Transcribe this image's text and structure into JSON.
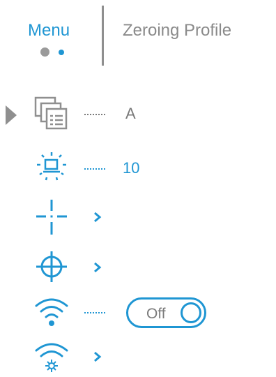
{
  "colors": {
    "accent": "#1f96d3",
    "muted": "#8f8f8f",
    "text_gray": "#7a7a7a"
  },
  "header": {
    "tabs": [
      {
        "label": "Menu",
        "active": true
      },
      {
        "label": "Zeroing Profile",
        "active": false
      }
    ],
    "page_indicator": {
      "pages": 2,
      "current": 2
    }
  },
  "menu": {
    "items": [
      {
        "icon": "profile-copy-icon",
        "value": "A",
        "selected": true
      },
      {
        "icon": "display-brightness-icon",
        "value": "10"
      },
      {
        "icon": "reticle-icon",
        "type": "submenu"
      },
      {
        "icon": "crosshair-target-icon",
        "type": "submenu"
      },
      {
        "icon": "wifi-icon",
        "type": "toggle",
        "toggle_label": "Off"
      },
      {
        "icon": "wifi-settings-icon",
        "type": "submenu"
      }
    ]
  }
}
